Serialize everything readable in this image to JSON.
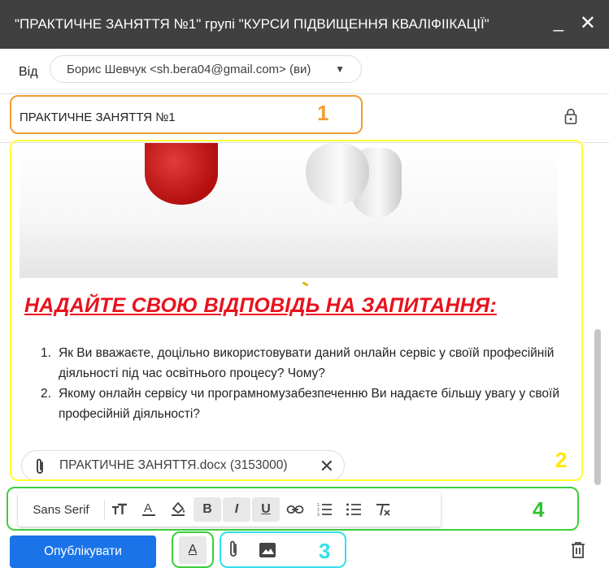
{
  "window": {
    "title": "\"ПРАКТИЧНЕ ЗАНЯТТЯ №1\" групі \"КУРСИ ПІДВИЩЕННЯ КВАЛІФІІКАЦІЇ\"",
    "minimize_glyph": "_",
    "close_glyph": "✕"
  },
  "from": {
    "label": "Від",
    "value": "Борис Шевчук <sh.bera04@gmail.com> (ви)"
  },
  "subject": {
    "value": "ПРАКТИЧНЕ ЗАНЯТТЯ №1"
  },
  "body": {
    "heading": "НАДАЙТЕ СВОЮ ВІДПОВІДЬ НА ЗАПИТАННЯ:",
    "questions": [
      {
        "num": "1.",
        "text": "Як Ви вважаєте, доцільно використовувати даний онлайн сервіс у своїй професійній діяльності під час освітнього процесу? Чому?"
      },
      {
        "num": "2.",
        "text": "Якому онлайн сервісу чи програмномузабезпеченню Ви надаєте більшу увагу у своїй професійній діяльності?"
      }
    ]
  },
  "attachment": {
    "name": "ПРАКТИЧНЕ ЗАНЯТТЯ.docx (3153000)"
  },
  "formatting": {
    "font": "Sans Serif",
    "bold": "B",
    "italic": "I",
    "underline": "U"
  },
  "actions": {
    "publish_label": "Опублікувати",
    "text_format_label": "A"
  },
  "annotations": {
    "n1": "1",
    "n2": "2",
    "n3": "3",
    "n4": "4"
  },
  "colors": {
    "annotation_1": "#f39c32",
    "annotation_2": "#ffff33",
    "annotation_3": "#33e0e8",
    "annotation_4": "#3ccf3c",
    "heading": "#e8121d",
    "primary_button": "#1a73e8"
  }
}
